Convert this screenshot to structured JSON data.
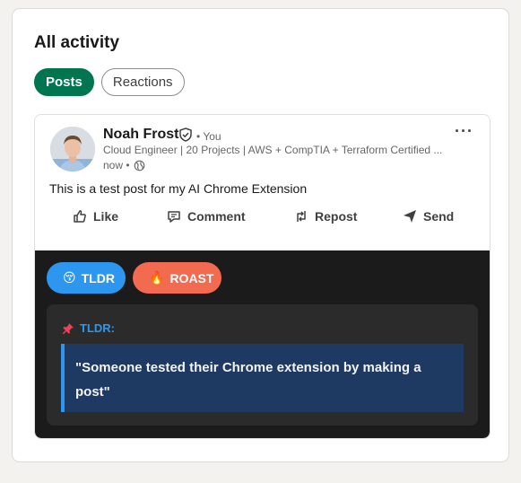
{
  "section": {
    "title": "All activity"
  },
  "tabs": [
    {
      "label": "Posts",
      "active": true
    },
    {
      "label": "Reactions",
      "active": false
    }
  ],
  "post": {
    "author": {
      "name": "Noah Frost",
      "degree": "• You",
      "headline": "Cloud Engineer | 20 Projects | AWS + CompTIA + Terraform Certified ...",
      "time": "now •"
    },
    "text": "This is a test post for my AI Chrome Extension",
    "actions": {
      "like": "Like",
      "comment": "Comment",
      "repost": "Repost",
      "send": "Send"
    },
    "more_label": "···"
  },
  "extension": {
    "tldr_button": {
      "emoji": "😚",
      "label": "TLDR"
    },
    "roast_button": {
      "emoji": "🔥",
      "label": "ROAST"
    },
    "result": {
      "label": "TLDR:",
      "text": "\"Someone tested their Chrome extension by making a post\""
    }
  },
  "colors": {
    "brand_green": "#01754f",
    "tldr_blue": "#2d97f0",
    "roast_orange": "#f26a4f",
    "panel_dark": "#1b1b1b",
    "quote_bg": "#1f3a62"
  },
  "icons": [
    "verified-shield-icon",
    "globe-icon",
    "like-icon",
    "comment-icon",
    "repost-icon",
    "send-icon",
    "pin-icon",
    "more-icon"
  ]
}
